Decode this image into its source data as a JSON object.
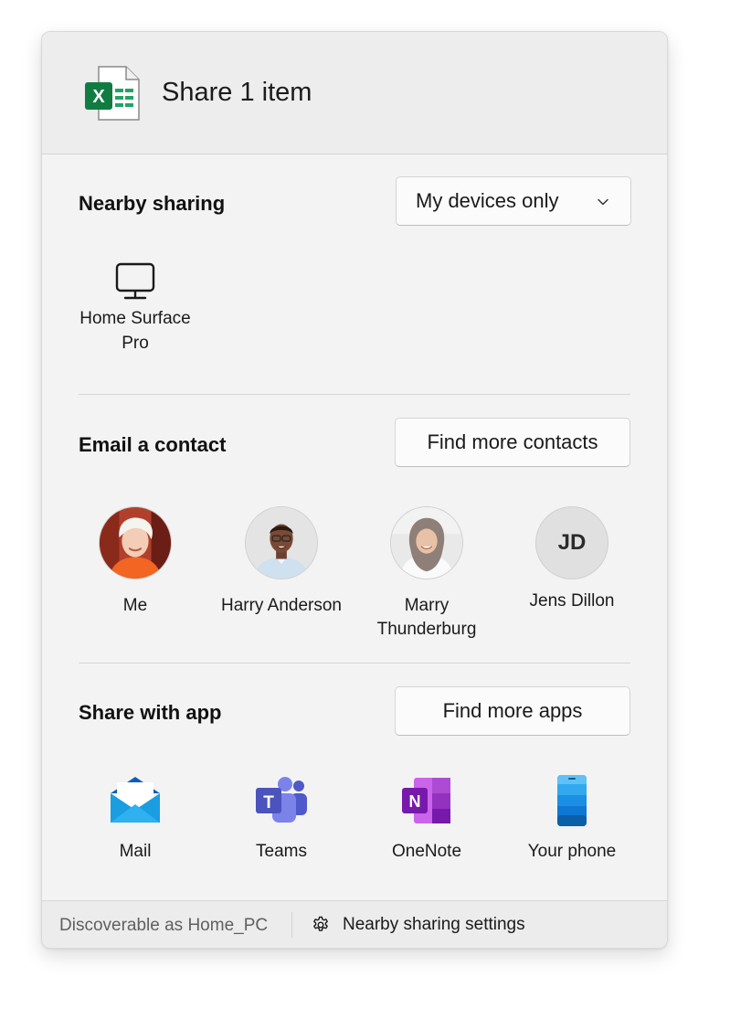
{
  "header": {
    "title": "Share 1 item",
    "file_icon": "excel-file-icon"
  },
  "nearby": {
    "title": "Nearby sharing",
    "dropdown_value": "My devices only",
    "devices": [
      {
        "label_line1": "Home Surface",
        "label_line2": "Pro",
        "icon": "monitor-icon"
      }
    ]
  },
  "email": {
    "title": "Email a contact",
    "find_button": "Find more contacts",
    "contacts": [
      {
        "name": "Me"
      },
      {
        "name": "Harry Anderson"
      },
      {
        "name_line1": "Marry",
        "name_line2": "Thunderburg"
      },
      {
        "name": "Jens Dillon",
        "initials": "JD"
      }
    ]
  },
  "apps": {
    "title": "Share with app",
    "find_button": "Find more apps",
    "items": [
      {
        "label": "Mail",
        "icon": "mail-icon"
      },
      {
        "label": "Teams",
        "icon": "teams-icon"
      },
      {
        "label": "OneNote",
        "icon": "onenote-icon"
      },
      {
        "label": "Your phone",
        "icon": "phone-icon"
      }
    ]
  },
  "footer": {
    "discoverable": "Discoverable as Home_PC",
    "settings_label": "Nearby sharing settings"
  }
}
